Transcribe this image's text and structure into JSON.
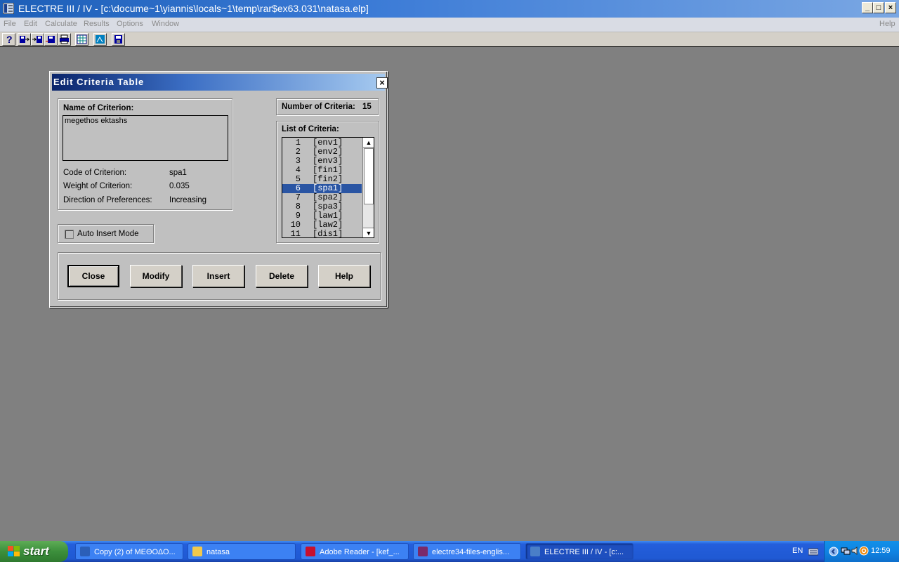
{
  "window": {
    "title": "ELECTRE  III / IV - [c:\\docume~1\\yiannis\\locals~1\\temp\\rar$ex63.031\\natasa.elp]",
    "minimize": "_",
    "maximize": "□",
    "close": "×"
  },
  "menu": {
    "items": [
      "File",
      "Edit",
      "Calculate",
      "Results",
      "Options",
      "Window"
    ],
    "help": "Help"
  },
  "toolbar": {
    "icons": [
      "help-icon",
      "save-icon",
      "open-icon",
      "export-icon",
      "print-icon",
      "calculator-icon",
      "chart-icon",
      "disk-icon"
    ]
  },
  "dialog": {
    "title": "Edit  Criteria  Table",
    "close": "×",
    "name_label": "Name of Criterion:",
    "name_value": "megethos ektashs",
    "code_label": "Code of Criterion:",
    "code_value": "spa1",
    "weight_label": "Weight of Criterion:",
    "weight_value": "0.035",
    "direction_label": "Direction of Preferences:",
    "direction_value": "Increasing",
    "auto_insert_label": "Auto Insert Mode",
    "auto_insert_checked": false,
    "count_label": "Number of Criteria:",
    "count_value": "15",
    "list_label": "List of Criteria:",
    "criteria": [
      {
        "num": "1",
        "code": "[env1]"
      },
      {
        "num": "2",
        "code": "[env2]"
      },
      {
        "num": "3",
        "code": "[env3]"
      },
      {
        "num": "4",
        "code": "[fin1]"
      },
      {
        "num": "5",
        "code": "[fin2]"
      },
      {
        "num": "6",
        "code": "[spa1]"
      },
      {
        "num": "7",
        "code": "[spa2]"
      },
      {
        "num": "8",
        "code": "[spa3]"
      },
      {
        "num": "9",
        "code": "[law1]"
      },
      {
        "num": "10",
        "code": "[law2]"
      },
      {
        "num": "11",
        "code": "[dis1]"
      }
    ],
    "selected_index": 5,
    "buttons": {
      "close": "Close",
      "modify": "Modify",
      "insert": "Insert",
      "delete": "Delete",
      "help": "Help"
    }
  },
  "taskbar": {
    "start": "start",
    "tasks": [
      {
        "label": "Copy (2) of ΜΕΘΟΔΟ...",
        "icon": "word-icon",
        "color": "#2b5fb8"
      },
      {
        "label": "natasa",
        "icon": "folder-icon",
        "color": "#f2c94c"
      },
      {
        "label": "Adobe Reader - [kef_...",
        "icon": "adobe-icon",
        "color": "#c8102e"
      },
      {
        "label": "electre34-files-englis...",
        "icon": "winrar-icon",
        "color": "#7a2a6a"
      },
      {
        "label": "ELECTRE  III / IV - [c:...",
        "icon": "electre-icon",
        "color": "#4a7fc8"
      }
    ],
    "language": "EN",
    "clock": "12:59"
  }
}
